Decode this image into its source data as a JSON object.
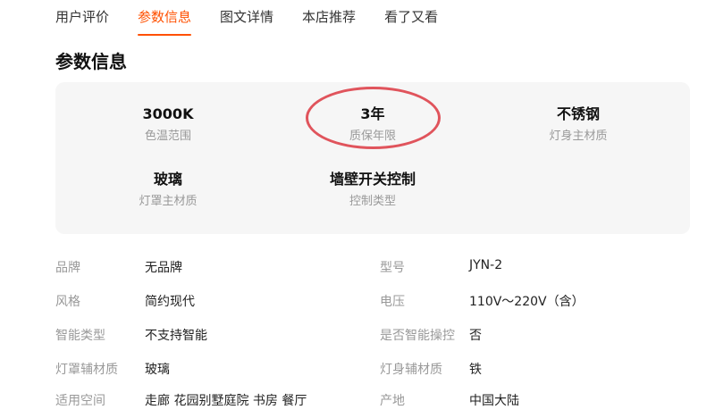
{
  "tabs": [
    {
      "label": "用户评价",
      "active": false
    },
    {
      "label": "参数信息",
      "active": true
    },
    {
      "label": "图文详情",
      "active": false
    },
    {
      "label": "本店推荐",
      "active": false
    },
    {
      "label": "看了又看",
      "active": false
    }
  ],
  "accent_color": "#ff5000",
  "highlight_color": "#e0545c",
  "section_title": "参数信息",
  "highlights": [
    {
      "value": "3000K",
      "label": "色温范围"
    },
    {
      "value": "3年",
      "label": "质保年限"
    },
    {
      "value": "不锈钢",
      "label": "灯身主材质"
    },
    {
      "value": "玻璃",
      "label": "灯罩主材质"
    },
    {
      "value": "墙壁开关控制",
      "label": "控制类型"
    }
  ],
  "properties": [
    {
      "left_label": "品牌",
      "left_value": "无品牌",
      "right_label": "型号",
      "right_value": "JYN-2"
    },
    {
      "left_label": "风格",
      "left_value": "简约现代",
      "right_label": "电压",
      "right_value": "110V～220V（含）"
    },
    {
      "left_label": "智能类型",
      "left_value": "不支持智能",
      "right_label": "是否智能操控",
      "right_value": "否"
    },
    {
      "left_label": "灯罩辅材质",
      "left_value": "玻璃",
      "right_label": "灯身辅材质",
      "right_value": "铁"
    },
    {
      "left_label": "适用空间",
      "left_value": "走廊 花园别墅庭院 书房 餐厅",
      "right_label": "产地",
      "right_value": "中国大陆"
    }
  ]
}
